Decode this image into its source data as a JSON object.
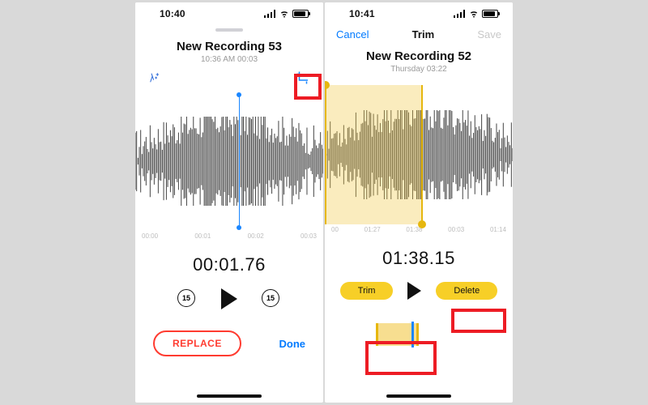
{
  "left": {
    "status_time": "10:40",
    "title": "New Recording 53",
    "subtitle": "10:36 AM  00:03",
    "icons": {
      "enhance": "enhance-icon",
      "crop": "crop-icon"
    },
    "axis": [
      "00:00",
      "00:01",
      "00:02",
      "00:03"
    ],
    "playhead_pct": 55,
    "timecode": "00:01.76",
    "skip_amount": "15",
    "replace_label": "REPLACE",
    "done_label": "Done"
  },
  "right": {
    "status_time": "10:41",
    "nav": {
      "cancel": "Cancel",
      "title": "Trim",
      "save": "Save"
    },
    "title": "New Recording 52",
    "subtitle": "Thursday  03:22",
    "axis": [
      "00",
      "01:27",
      "01:38",
      "00:03",
      "01:14"
    ],
    "sel_start_pct": 0,
    "sel_end_pct": 52,
    "timecode": "01:38.15",
    "trim_label": "Trim",
    "delete_label": "Delete",
    "scrubber_sel": {
      "start_pct": 22,
      "end_pct": 50
    },
    "scrubber_cursor_pct": 45
  }
}
